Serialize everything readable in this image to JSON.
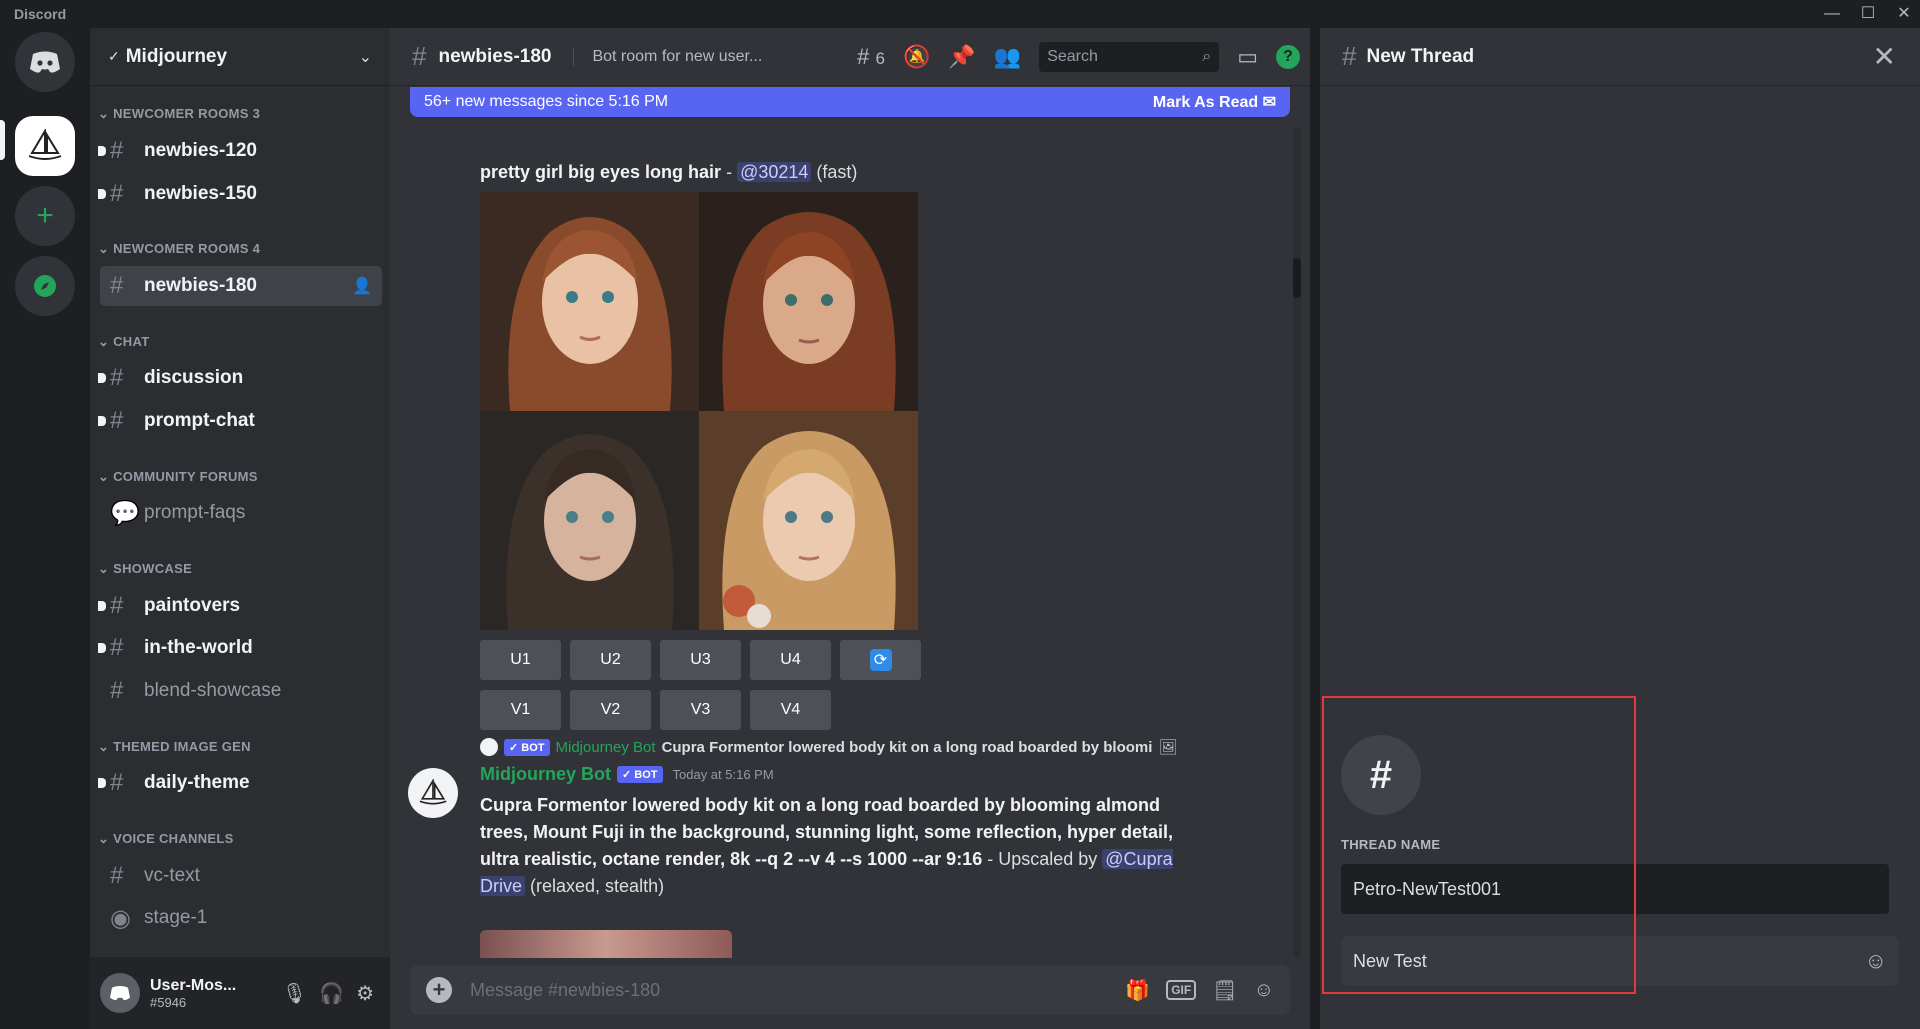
{
  "app": {
    "title": "Discord"
  },
  "window": {
    "minimize": "—",
    "maximize": "☐",
    "close": "✕"
  },
  "guild": {
    "name": "Midjourney"
  },
  "categories": [
    {
      "label": "NEWCOMER ROOMS 3"
    },
    {
      "label": "NEWCOMER ROOMS 4"
    },
    {
      "label": "CHAT"
    },
    {
      "label": "COMMUNITY FORUMS"
    },
    {
      "label": "SHOWCASE"
    },
    {
      "label": "THEMED IMAGE GEN"
    },
    {
      "label": "VOICE CHANNELS"
    }
  ],
  "channels": [
    {
      "name": "newbies-120"
    },
    {
      "name": "newbies-150"
    },
    {
      "name": "newbies-180"
    },
    {
      "name": "discussion"
    },
    {
      "name": "prompt-chat"
    },
    {
      "name": "prompt-faqs"
    },
    {
      "name": "paintovers"
    },
    {
      "name": "in-the-world"
    },
    {
      "name": "blend-showcase"
    },
    {
      "name": "daily-theme"
    },
    {
      "name": "vc-text"
    },
    {
      "name": "stage-1"
    }
  ],
  "user": {
    "name": "User-Mos...",
    "tag": "#5946"
  },
  "header": {
    "channel": "newbies-180",
    "topic": "Bot room for new user...",
    "thread_count": "6",
    "search_placeholder": "Search"
  },
  "new_messages": {
    "text": "56+ new messages since 5:16 PM",
    "mark_read": "Mark As Read"
  },
  "message1": {
    "prompt": "pretty girl big eyes long hair",
    "sep": " - ",
    "mention": "@30214",
    "mode": " (fast)"
  },
  "buttons": {
    "row1": [
      "U1",
      "U2",
      "U3",
      "U4"
    ],
    "row2": [
      "V1",
      "V2",
      "V3",
      "V4"
    ]
  },
  "reply": {
    "badge": "✓ BOT",
    "author": "Midjourney Bot",
    "snippet": "Cupra Formentor lowered body kit on a long road boarded by bloomi"
  },
  "message2": {
    "author": "Midjourney Bot",
    "badge": "✓ BOT",
    "time": "Today at 5:16 PM",
    "prompt": "Cupra Formentor lowered body kit on a long road boarded by blooming almond trees, Mount Fuji in the background, stunning light, some reflection, hyper detail, ultra realistic, octane render, 8k --q 2 --v 4 --s 1000 --ar 9:16",
    "suffix": " - Upscaled by ",
    "mention": "@Cupra Drive",
    "mode": " (relaxed, stealth)"
  },
  "composer": {
    "placeholder": "Message #newbies-180",
    "gif": "GIF"
  },
  "thread": {
    "title": "New Thread",
    "name_label": "THREAD NAME",
    "name_value": "Petro-NewTest001",
    "message_value": "New Test"
  },
  "colors": {
    "accent": "#5865f2",
    "online_green": "#23a55a",
    "highlight_red": "#e03a3a"
  }
}
